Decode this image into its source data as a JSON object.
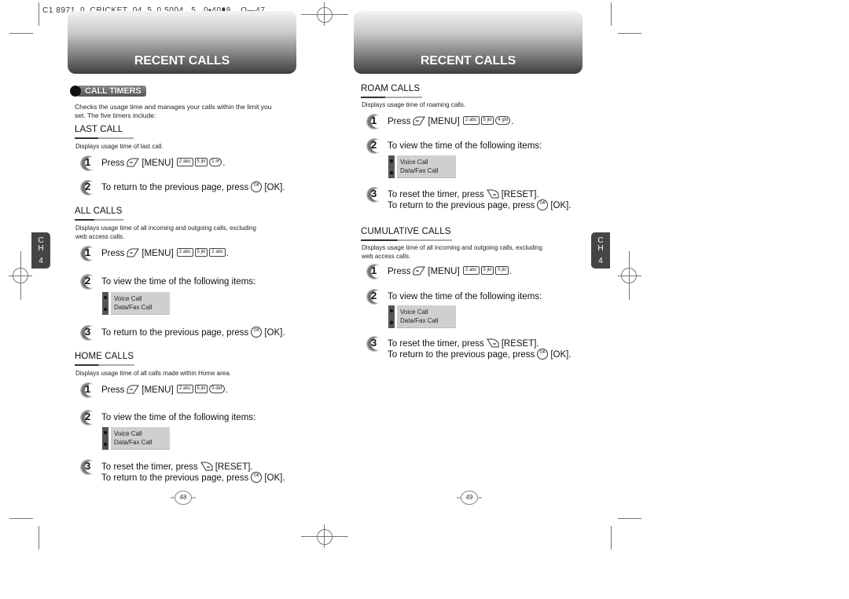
{
  "filename_label": "C1 8971_0_CRICKET_04_5_0 5004._5._0▪40▮8__O—47",
  "pages": {
    "left": {
      "header_title": "RECENT CALLS",
      "section_label": "CALL TIMERS",
      "intro_line1": "Checks the usage time and manages your calls within the limit you",
      "intro_line2": "set. The five timers include:",
      "chapter": {
        "letters": "C\nH",
        "number": "4"
      },
      "page_number": "48",
      "last_call": {
        "heading": "LAST CALL",
        "desc": "Displays usage time of last call.",
        "step1": {
          "num": "1",
          "press": "Press",
          "menu": "[MENU]",
          "keys": [
            "2 abc",
            "5 jkl",
            "1 ✉"
          ],
          "end": "."
        },
        "step2": {
          "num": "2",
          "text": "To return to the previous page, press",
          "ok_label": "[OK]."
        }
      },
      "all_calls": {
        "heading": "ALL CALLS",
        "desc_line1": "Displays usage time of all incoming and outgoing calls, excluding",
        "desc_line2": "web access calls.",
        "step1": {
          "num": "1",
          "press": "Press",
          "menu": "[MENU]",
          "keys": [
            "2 abc",
            "5 jkl",
            "2 abc"
          ],
          "end": "."
        },
        "step2": {
          "num": "2",
          "text": "To view the time of the following items:"
        },
        "items": [
          "Voice Call",
          "Data/Fax Call"
        ],
        "step3": {
          "num": "3",
          "text": "To return to the previous page, press",
          "ok_label": "[OK]."
        }
      },
      "home_calls": {
        "heading": "HOME CALLS",
        "desc": "Displays usage time of all calls made within Home area.",
        "step1": {
          "num": "1",
          "press": "Press",
          "menu": "[MENU]",
          "keys": [
            "2 abc",
            "5 jkl",
            "3 def"
          ],
          "end": "."
        },
        "step2": {
          "num": "2",
          "text": "To view the time of the following items:"
        },
        "items": [
          "Voice Call",
          "Data/Fax Call"
        ],
        "step3": {
          "num": "3",
          "reset_text": "To reset the timer, press",
          "reset_label": "[RESET].",
          "return_text": "To return to the previous page, press",
          "ok_label": "[OK]."
        }
      }
    },
    "right": {
      "header_title": "RECENT CALLS",
      "chapter": {
        "letters": "C\nH",
        "number": "4"
      },
      "page_number": "49",
      "roam_calls": {
        "heading": "ROAM CALLS",
        "desc": "Displays usage time of roaming calls.",
        "step1": {
          "num": "1",
          "press": "Press",
          "menu": "[MENU]",
          "keys": [
            "2 abc",
            "5 jkl",
            "4 ghi"
          ],
          "end": "."
        },
        "step2": {
          "num": "2",
          "text": "To view the time of the following items:"
        },
        "items": [
          "Voice Call",
          "Data/Fax Call"
        ],
        "step3": {
          "num": "3",
          "reset_text": "To reset the timer, press",
          "reset_label": "[RESET].",
          "return_text": "To return to the previous page, press",
          "ok_label": "[OK]."
        }
      },
      "cumulative_calls": {
        "heading": "CUMULATIVE CALLS",
        "desc_line1": "Displays usage time of all incoming and outgoing calls, excluding",
        "desc_line2": "web access calls.",
        "step1": {
          "num": "1",
          "press": "Press",
          "menu": "[MENU]",
          "keys": [
            "2 abc",
            "5 jkl",
            "5 jkl"
          ],
          "end": "."
        },
        "step2": {
          "num": "2",
          "text": "To view the time of the following items:"
        },
        "items": [
          "Voice Call",
          "Data/Fax Call"
        ],
        "step3": {
          "num": "3",
          "reset_text": "To reset the timer, press",
          "reset_label": "[RESET].",
          "return_text": "To return to the previous page, press",
          "ok_label": "[OK]."
        }
      }
    }
  },
  "icons": {
    "left_soft_key": "left-soft-key-icon",
    "right_soft_key": "right-soft-key-icon",
    "ok_key": "ok-key-icon",
    "ok_key_glyph": "OK"
  }
}
